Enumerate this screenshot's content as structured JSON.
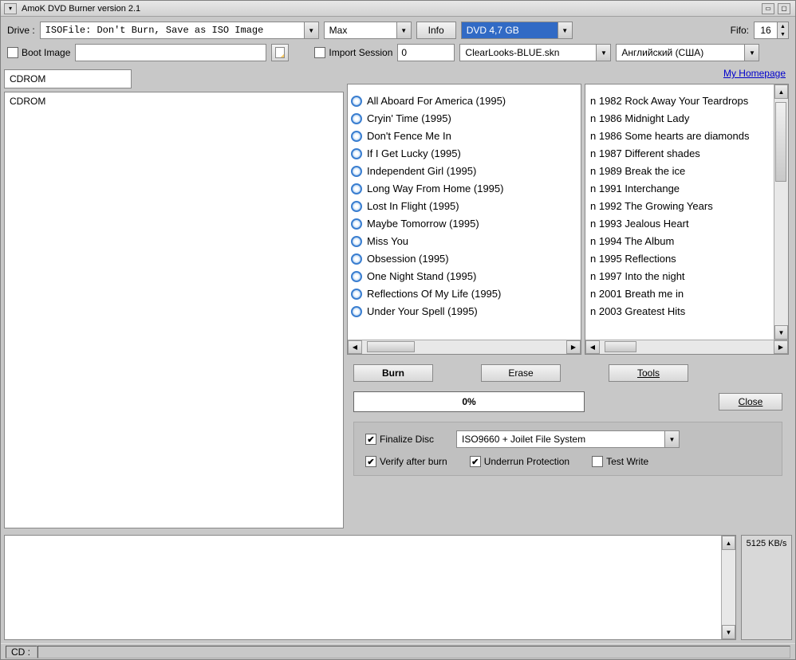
{
  "title": "AmoK DVD Burner version 2.1",
  "toolbar": {
    "drive_label": "Drive :",
    "drive_value": "ISOFile: Don't Burn, Save as ISO Image",
    "speed_value": "Max",
    "info_label": "Info",
    "disc_type": "DVD 4,7 GB",
    "fifo_label": "Fifo:",
    "fifo_value": "16"
  },
  "row2": {
    "boot_image_label": "Boot Image",
    "boot_image_value": "",
    "import_session_label": "Import Session",
    "import_session_value": "0",
    "skin_value": "ClearLooks-BLUE.skn",
    "lang_value": "Английский (США)"
  },
  "homepage_link": "My Homepage",
  "tree": {
    "header": "CDROM",
    "root": "CDROM"
  },
  "tracks": [
    "All Aboard For America (1995)",
    "Cryin' Time (1995)",
    "Don't Fence Me In",
    "If I Get Lucky (1995)",
    "Independent Girl (1995)",
    "Long Way From Home (1995)",
    "Lost In Flight (1995)",
    "Maybe Tomorrow (1995)",
    "Miss You",
    "Obsession (1995)",
    "One Night Stand (1995)",
    "Reflections Of My Life (1995)",
    "Under Your Spell (1995)"
  ],
  "albums": [
    "n 1982 Rock Away Your Teardrops",
    "n 1986 Midnight Lady",
    "n 1986 Some hearts are diamonds",
    "n 1987 Different shades",
    "n 1989 Break the ice",
    "n 1991 Interchange",
    "n 1992 The Growing Years",
    "n 1993 Jealous Heart",
    "n 1994 The Album",
    "n 1995 Reflections",
    "n 1997 Into the night",
    "n 2001 Breath me in",
    "n 2003 Greatest Hits"
  ],
  "buttons": {
    "burn": "Burn",
    "erase": "Erase",
    "tools": "Tools",
    "close": "Close"
  },
  "progress": "0%",
  "options": {
    "finalize": "Finalize Disc",
    "filesystem": "ISO9660 + Joilet File System",
    "verify": "Verify after burn",
    "underrun": "Underrun Protection",
    "testwrite": "Test Write"
  },
  "speed_display": "5125 KB/s",
  "status": {
    "cd_label": "CD :"
  }
}
